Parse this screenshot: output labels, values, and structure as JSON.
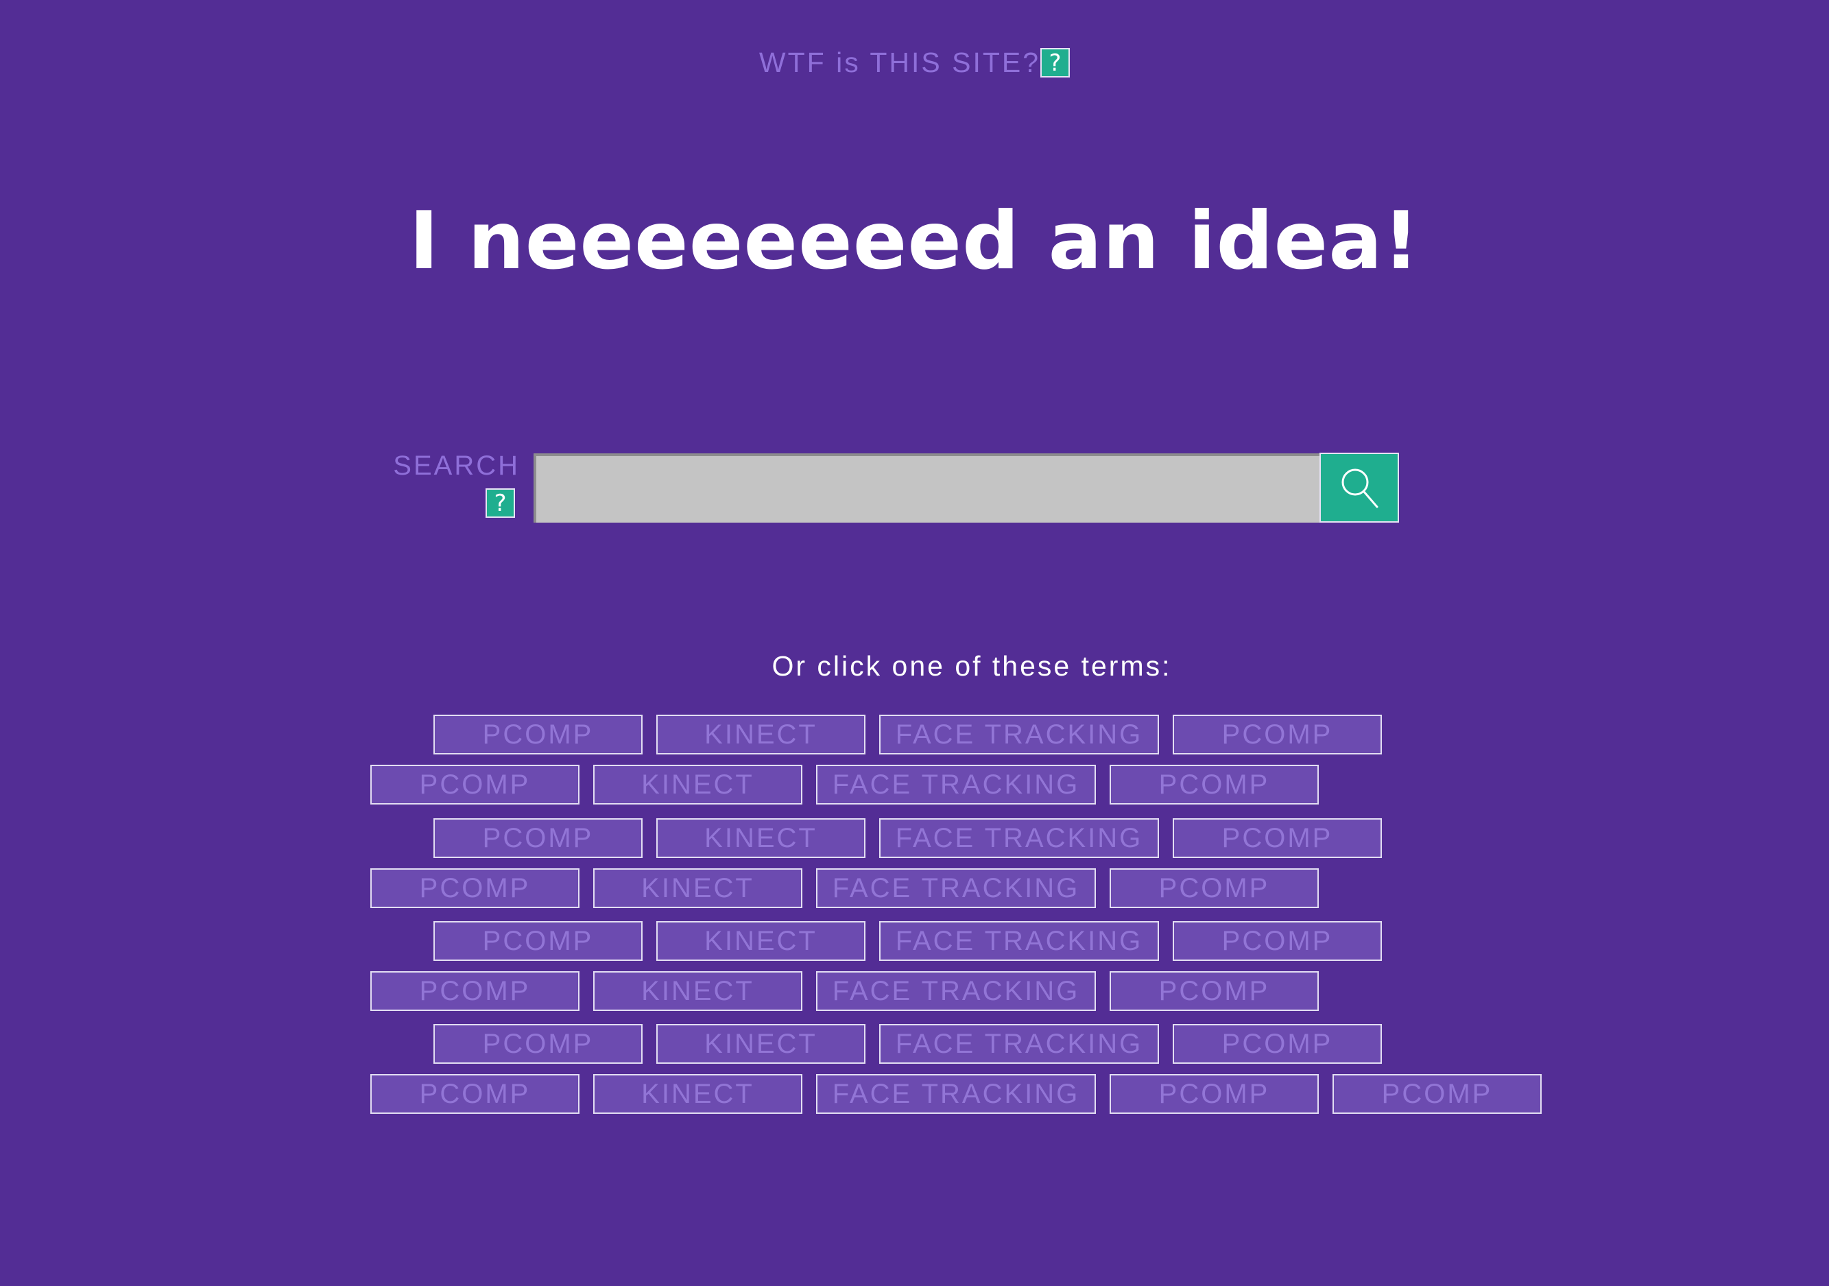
{
  "header": {
    "site_link_label": "WTF is THIS SITE?",
    "help_glyph": "?"
  },
  "headline": "I neeeeeeeed an idea!",
  "search": {
    "label": "SEARCH",
    "help_glyph": "?",
    "value": "",
    "placeholder": "",
    "button_icon": "magnifier-icon"
  },
  "terms": {
    "caption": "Or click one of these terms:",
    "rows": [
      [
        "PCOMP",
        "KINECT",
        "FACE TRACKING",
        "PCOMP"
      ],
      [
        "PCOMP",
        "KINECT",
        "FACE TRACKING",
        "PCOMP"
      ],
      [
        "PCOMP",
        "KINECT",
        "FACE TRACKING",
        "PCOMP"
      ],
      [
        "PCOMP",
        "KINECT",
        "FACE TRACKING",
        "PCOMP"
      ],
      [
        "PCOMP",
        "KINECT",
        "FACE TRACKING",
        "PCOMP"
      ],
      [
        "PCOMP",
        "KINECT",
        "FACE TRACKING",
        "PCOMP"
      ],
      [
        "PCOMP",
        "KINECT",
        "FACE TRACKING",
        "PCOMP"
      ],
      [
        "PCOMP",
        "KINECT",
        "FACE TRACKING",
        "PCOMP",
        "PCOMP"
      ]
    ]
  },
  "colors": {
    "background": "#532d95",
    "accent_teal": "#1fae8f",
    "term_fill": "#6c4bb0",
    "muted_text": "#8f6fd9"
  }
}
